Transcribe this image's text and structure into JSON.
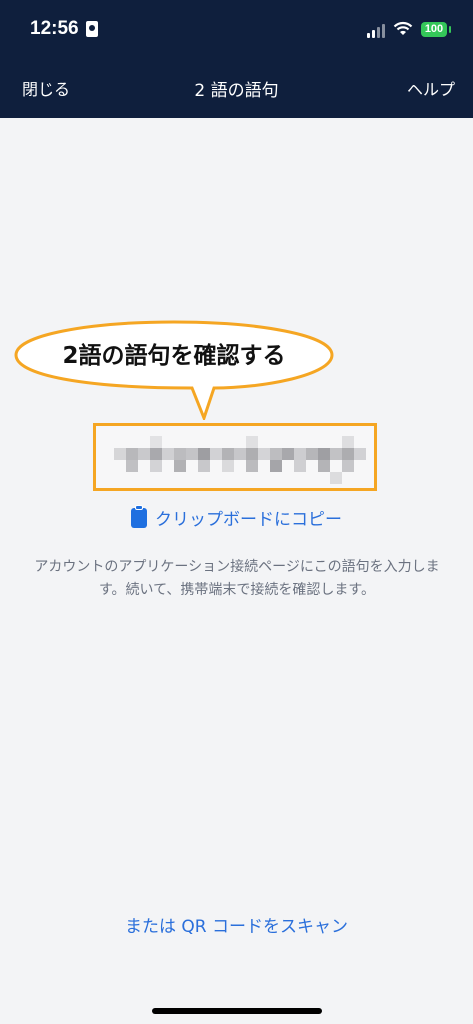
{
  "status_bar": {
    "time": "12:56",
    "battery": "100"
  },
  "nav": {
    "close_label": "閉じる",
    "title": "2 語の語句",
    "help_label": "ヘルプ"
  },
  "callout": {
    "text": "2語の語句を確認する"
  },
  "phrase": {
    "copy_label": "クリップボードにコピー"
  },
  "description": "アカウントのアプリケーション接続ページにこの語句を入力します。続いて、携帯端末で接続を確認します。",
  "footer": {
    "qr_link": "または QR コードをスキャン"
  },
  "colors": {
    "nav_bg": "#0f1f3d",
    "accent": "#2a6fdb",
    "highlight": "#f5a623",
    "battery": "#34c759"
  }
}
